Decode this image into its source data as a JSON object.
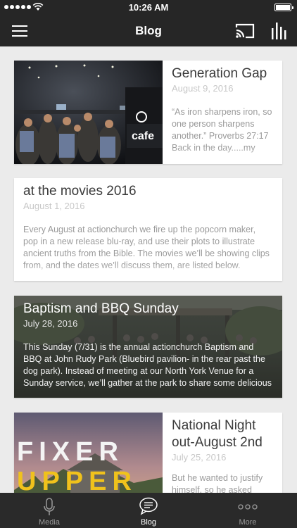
{
  "status_bar": {
    "time": "10:26 AM"
  },
  "nav": {
    "title": "Blog"
  },
  "posts": [
    {
      "title": "Generation Gap",
      "date": "August 9, 2016",
      "excerpt": "“As iron sharpens iron, so one person sharpens another.” Proverbs 27:17 Back in the day.....my memory"
    },
    {
      "title": "at the movies 2016",
      "date": "August 1, 2016",
      "excerpt": "Every August at actionchurch we fire up the popcorn maker, pop in a new release blu-ray, and use their plots to illustrate ancient truths from the Bible.  The movies we’ll be showing clips from, and the dates we’ll discuss them, are listed below."
    },
    {
      "title": "Baptism and BBQ Sunday",
      "date": "July 28, 2016",
      "excerpt": "This Sunday (7/31) is the annual actionchurch Baptism and BBQ at John Rudy Park (Bluebird pavilion- in the rear past the dog park).  Instead of meeting at our North York Venue for a Sunday service, we’ll gather at the park to share some delicious food"
    },
    {
      "title": "National Night out-August 2nd",
      "date": "July 25, 2016",
      "excerpt": "But he wanted to justify himself, so he asked"
    }
  ],
  "thumbnails": {
    "cafe_sign": "cafe",
    "fixer_line1": "FIXER",
    "fixer_line2": "UPPER"
  },
  "tabs": [
    {
      "label": "Media",
      "icon": "microphone-icon"
    },
    {
      "label": "Blog",
      "icon": "chat-bubble-icon"
    },
    {
      "label": "More",
      "icon": "more-dots-icon"
    }
  ],
  "colors": {
    "bar_background": "#262626",
    "page_background": "#ebebeb",
    "title_text": "#3a3a3a",
    "date_text": "#c8c8c8"
  }
}
